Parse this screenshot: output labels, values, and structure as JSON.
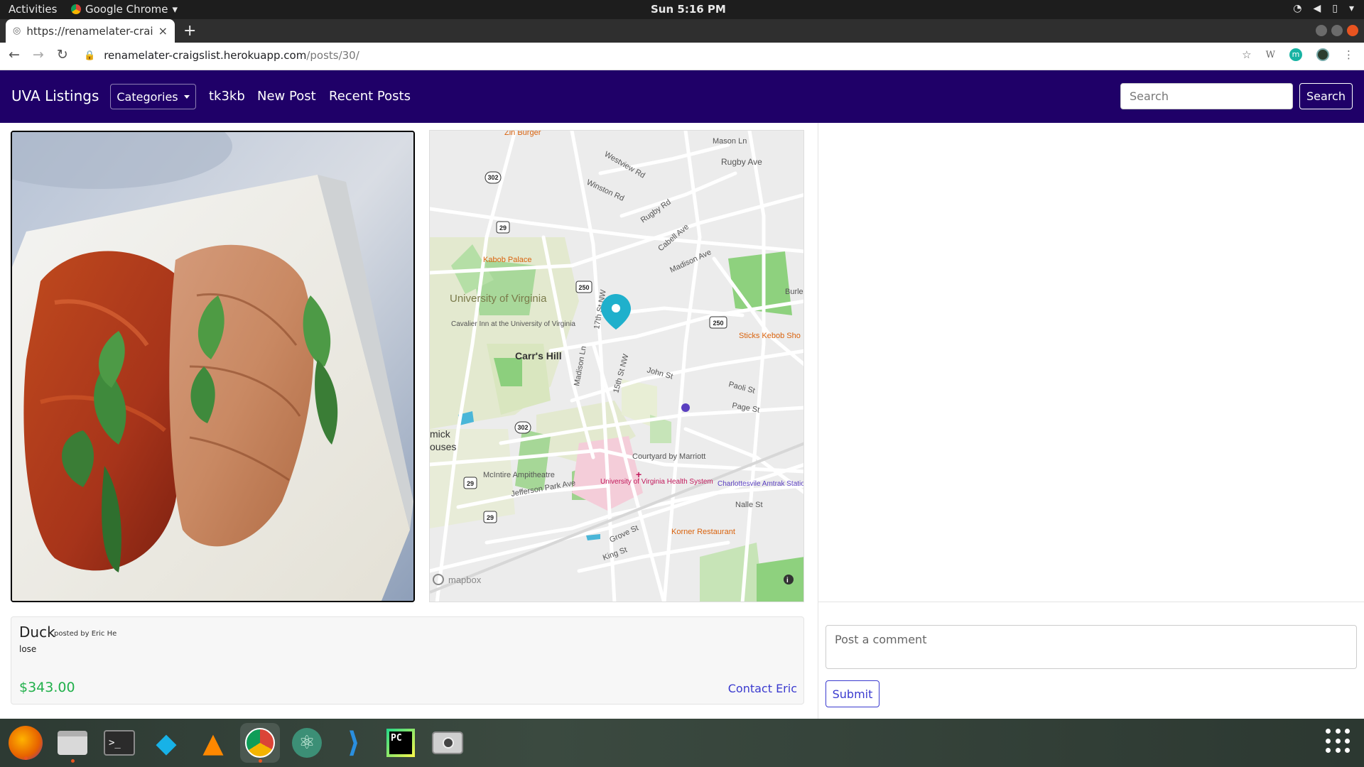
{
  "os": {
    "activities": "Activities",
    "app_name": "Google Chrome",
    "clock": "Sun  5:16 PM"
  },
  "browser": {
    "tab_title": "https://renamelater-craig",
    "url_host": "renamelater-craigslist.herokuapp.com",
    "url_path": "/posts/30/"
  },
  "navbar": {
    "brand": "UVA Listings",
    "categories_label": "Categories",
    "links": [
      "tk3kb",
      "New Post",
      "Recent Posts"
    ],
    "search_placeholder": "Search",
    "search_button": "Search"
  },
  "map": {
    "labels": {
      "university": "University of Virginia",
      "carrs_hill": "Carr's Hill",
      "kabob_palace": "Kabob Palace",
      "cavalier_inn": "Cavalier Inn at the University of Virginia",
      "rugby_ave": "Rugby Ave",
      "rugby_rd": "Rugby Rd",
      "madison_ave": "Madison Ave",
      "mason_ln": "Mason Ln",
      "john_st": "John St",
      "paoli_st": "Paoli St",
      "page_st": "Page St",
      "nalle_st": "Nalle St",
      "jefferson_park": "Jefferson Park Ave",
      "mcintire": "McIntire Ampitheatre",
      "courtyard": "Courtyard by Marriott",
      "uva_health": "University of Virginia Health System",
      "amtrak": "Charlottesvile Amtrak Station Building",
      "korner": "Korner Restaurant",
      "sticks": "Sticks Kebob Sho",
      "zin": "Zin Burger",
      "burley": "Burle",
      "mapbox": "mapbox",
      "fifteenth": "15th St NW",
      "seventeenth": "17th St NW",
      "madison_ln": "Madison Ln",
      "winston_rd": "Winston Rd",
      "westview_rd": "Westview Rd",
      "cabell_ave": "Cabell Ave",
      "grove_st": "Grove St",
      "king_st": "King St",
      "mick_houses": "mick\nouses"
    },
    "shields": [
      "302",
      "29",
      "250",
      "250",
      "302",
      "29",
      "29"
    ]
  },
  "listing": {
    "title": "Duck",
    "byline": "posted by Eric He",
    "description": "lose",
    "price": "$343.00",
    "contact": "Contact Eric"
  },
  "comments": {
    "placeholder": "Post a comment",
    "submit": "Submit"
  },
  "colors": {
    "navbar": "#1f0068",
    "price": "#21b04b",
    "link": "#3a3acf"
  }
}
